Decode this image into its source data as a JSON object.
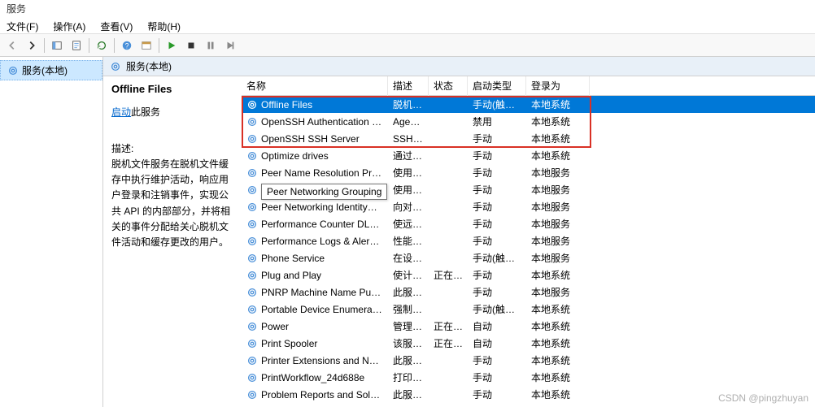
{
  "window_title": "服务",
  "menu": {
    "file": "文件(F)",
    "action": "操作(A)",
    "view": "查看(V)",
    "help": "帮助(H)"
  },
  "tree_root": "服务(本地)",
  "content_header": "服务(本地)",
  "detail": {
    "title": "Offline Files",
    "start_link": "启动",
    "start_suffix": "此服务",
    "desc_label": "描述:",
    "desc_body": "脱机文件服务在脱机文件缓存中执行维护活动，响应用户登录和注销事件，实现公共 API 的内部部分，并将相关的事件分配给关心脱机文件活动和缓存更改的用户。"
  },
  "columns": {
    "name": "名称",
    "desc": "描述",
    "status": "状态",
    "start": "启动类型",
    "logon": "登录为"
  },
  "tooltip": "Peer Networking Grouping",
  "watermark": "CSDN @pingzhuyan",
  "rows": [
    {
      "name": "Offline Files",
      "desc": "脱机…",
      "status": "",
      "start": "手动(触发…",
      "logon": "本地系统",
      "selected": true
    },
    {
      "name": "OpenSSH Authentication …",
      "desc": "Age…",
      "status": "",
      "start": "禁用",
      "logon": "本地系统"
    },
    {
      "name": "OpenSSH SSH Server",
      "desc": "SSH …",
      "status": "",
      "start": "手动",
      "logon": "本地系统"
    },
    {
      "name": "Optimize drives",
      "desc": "通过…",
      "status": "",
      "start": "手动",
      "logon": "本地系统"
    },
    {
      "name": "Peer Name Resolution Pr…",
      "desc": "使用…",
      "status": "",
      "start": "手动",
      "logon": "本地服务"
    },
    {
      "name": "Peer Networking Groupi…",
      "desc": "使用…",
      "status": "",
      "start": "手动",
      "logon": "本地服务"
    },
    {
      "name": "Peer Networking Identity…",
      "desc": "向对…",
      "status": "",
      "start": "手动",
      "logon": "本地服务"
    },
    {
      "name": "Performance Counter DL…",
      "desc": "使远…",
      "status": "",
      "start": "手动",
      "logon": "本地服务"
    },
    {
      "name": "Performance Logs & Aler…",
      "desc": "性能…",
      "status": "",
      "start": "手动",
      "logon": "本地服务"
    },
    {
      "name": "Phone Service",
      "desc": "在设…",
      "status": "",
      "start": "手动(触发…",
      "logon": "本地服务"
    },
    {
      "name": "Plug and Play",
      "desc": "使计…",
      "status": "正在…",
      "start": "手动",
      "logon": "本地系统"
    },
    {
      "name": "PNRP Machine Name Pu…",
      "desc": "此服…",
      "status": "",
      "start": "手动",
      "logon": "本地服务"
    },
    {
      "name": "Portable Device Enumera…",
      "desc": "强制…",
      "status": "",
      "start": "手动(触发…",
      "logon": "本地系统"
    },
    {
      "name": "Power",
      "desc": "管理…",
      "status": "正在…",
      "start": "自动",
      "logon": "本地系统"
    },
    {
      "name": "Print Spooler",
      "desc": "该服…",
      "status": "正在…",
      "start": "自动",
      "logon": "本地系统"
    },
    {
      "name": "Printer Extensions and N…",
      "desc": "此服…",
      "status": "",
      "start": "手动",
      "logon": "本地系统"
    },
    {
      "name": "PrintWorkflow_24d688e",
      "desc": "打印…",
      "status": "",
      "start": "手动",
      "logon": "本地系统"
    },
    {
      "name": "Problem Reports and Sol…",
      "desc": "此服…",
      "status": "",
      "start": "手动",
      "logon": "本地系统"
    }
  ]
}
